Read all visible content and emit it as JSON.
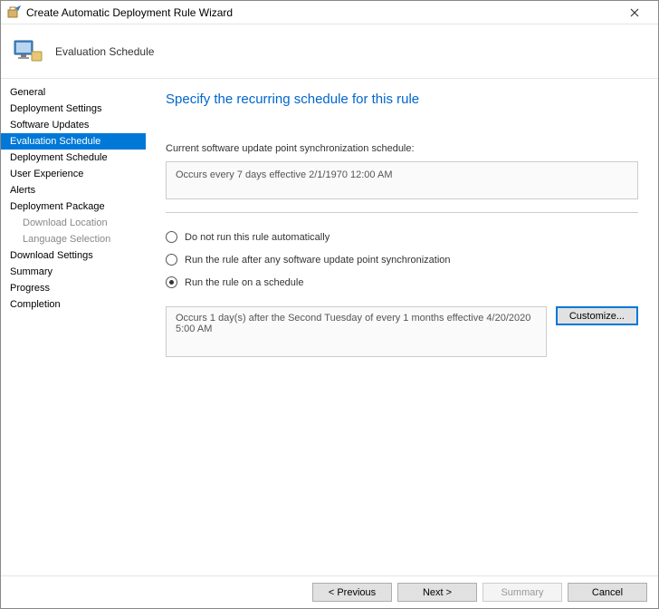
{
  "window": {
    "title": "Create Automatic Deployment Rule Wizard"
  },
  "header": {
    "title": "Evaluation Schedule"
  },
  "sidebar": {
    "items": [
      {
        "label": "General",
        "sub": false,
        "selected": false
      },
      {
        "label": "Deployment Settings",
        "sub": false,
        "selected": false
      },
      {
        "label": "Software Updates",
        "sub": false,
        "selected": false
      },
      {
        "label": "Evaluation Schedule",
        "sub": false,
        "selected": true
      },
      {
        "label": "Deployment Schedule",
        "sub": false,
        "selected": false
      },
      {
        "label": "User Experience",
        "sub": false,
        "selected": false
      },
      {
        "label": "Alerts",
        "sub": false,
        "selected": false
      },
      {
        "label": "Deployment Package",
        "sub": false,
        "selected": false
      },
      {
        "label": "Download Location",
        "sub": true,
        "selected": false
      },
      {
        "label": "Language Selection",
        "sub": true,
        "selected": false
      },
      {
        "label": "Download Settings",
        "sub": false,
        "selected": false
      },
      {
        "label": "Summary",
        "sub": false,
        "selected": false
      },
      {
        "label": "Progress",
        "sub": false,
        "selected": false
      },
      {
        "label": "Completion",
        "sub": false,
        "selected": false
      }
    ]
  },
  "main": {
    "title": "Specify the recurring schedule for this rule",
    "sync_label": "Current software update point synchronization schedule:",
    "sync_value": "Occurs every 7 days effective 2/1/1970 12:00 AM",
    "radio_options": {
      "none": "Do not run this rule automatically",
      "after_sync": "Run the rule after any software update point synchronization",
      "schedule": "Run the rule on a schedule"
    },
    "selected_option": "schedule",
    "schedule_value": "Occurs 1 day(s) after the Second Tuesday of every 1 months effective 4/20/2020 5:00 AM",
    "customize_label": "Customize..."
  },
  "footer": {
    "previous": "< Previous",
    "next": "Next >",
    "summary": "Summary",
    "cancel": "Cancel"
  }
}
